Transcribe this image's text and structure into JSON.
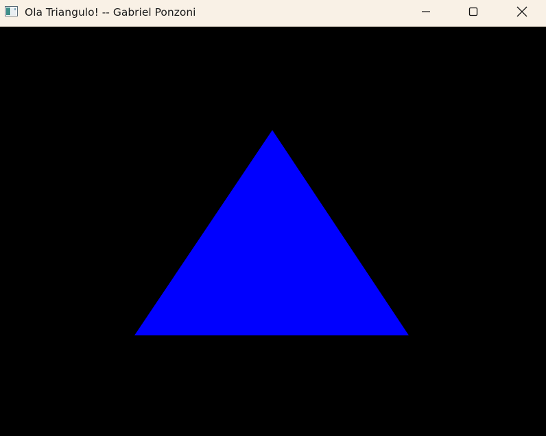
{
  "window": {
    "title": "Ola Triangulo! -- Gabriel Ponzoni",
    "icon": "app-window-icon",
    "controls": {
      "minimize": "minimize-icon",
      "maximize": "maximize-icon",
      "close": "close-icon"
    }
  },
  "colors": {
    "titlebar_bg": "#f9f1e6",
    "canvas_bg": "#000000",
    "triangle_fill": "#0000ff"
  },
  "scene": {
    "shape": "triangle"
  }
}
